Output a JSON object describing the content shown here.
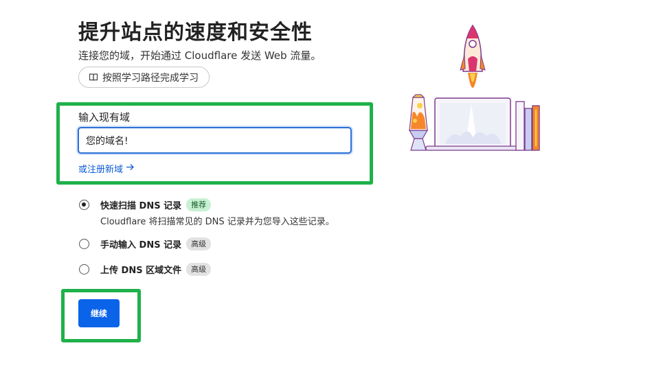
{
  "header": {
    "title": "提升站点的速度和安全性",
    "subtitle": "连接您的域，开始通过 Cloudflare 发送 Web 流量。",
    "learn_button_label": "按照学习路径完成学习",
    "learn_button_icon": "book-icon"
  },
  "domain_field": {
    "label": "输入现有域",
    "value": "您的域名!",
    "register_link_label": "或注册新域",
    "register_link_icon": "arrow-right-icon"
  },
  "dns_options": [
    {
      "label": "快速扫描 DNS 记录",
      "badge": "推荐",
      "description": "Cloudflare 将扫描常见的 DNS 记录并为您导入这些记录。",
      "selected": true
    },
    {
      "label": "手动输入 DNS 记录",
      "badge": "高级",
      "selected": false
    },
    {
      "label": "上传 DNS 区域文件",
      "badge": "高级",
      "selected": false
    }
  ],
  "continue_button_label": "继续",
  "colors": {
    "primary_button": "#0a63e8",
    "link": "#0b5bd3",
    "input_focus_border": "#2b6fd6",
    "highlight_box": "#1fb14a",
    "recommended_badge_bg": "#c8f0d2",
    "advanced_badge_bg": "#e2e2e2",
    "illustration_orange": "#f5872a",
    "illustration_purple": "#7b3a8c"
  },
  "illustration": {
    "icons": [
      "rocket-icon",
      "laptop-icon",
      "lava-lamp-icon",
      "books-icon"
    ]
  }
}
